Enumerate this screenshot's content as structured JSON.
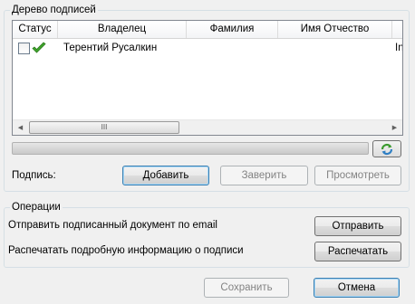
{
  "signature_tree": {
    "title": "Дерево подписей",
    "columns": [
      "Статус",
      "Владелец",
      "Фамилия",
      "Имя Отчество"
    ],
    "rows": [
      {
        "owner": "Терентий Русалкин",
        "overflow_text": "In"
      }
    ],
    "scroll_grip": "III",
    "signature_label": "Подпись:",
    "add_label": "Добавить",
    "certify_label": "Заверить",
    "view_label": "Просмотреть"
  },
  "operations": {
    "title": "Операции",
    "send_text": "Отправить подписанный документ по email",
    "send_label": "Отправить",
    "print_text": "Распечатать подробную информацию о подписи",
    "print_label": "Распечатать"
  },
  "footer": {
    "save_label": "Сохранить",
    "cancel_label": "Отмена"
  },
  "icons": {
    "status": "green-check-icon",
    "refresh": "refresh-icon"
  }
}
